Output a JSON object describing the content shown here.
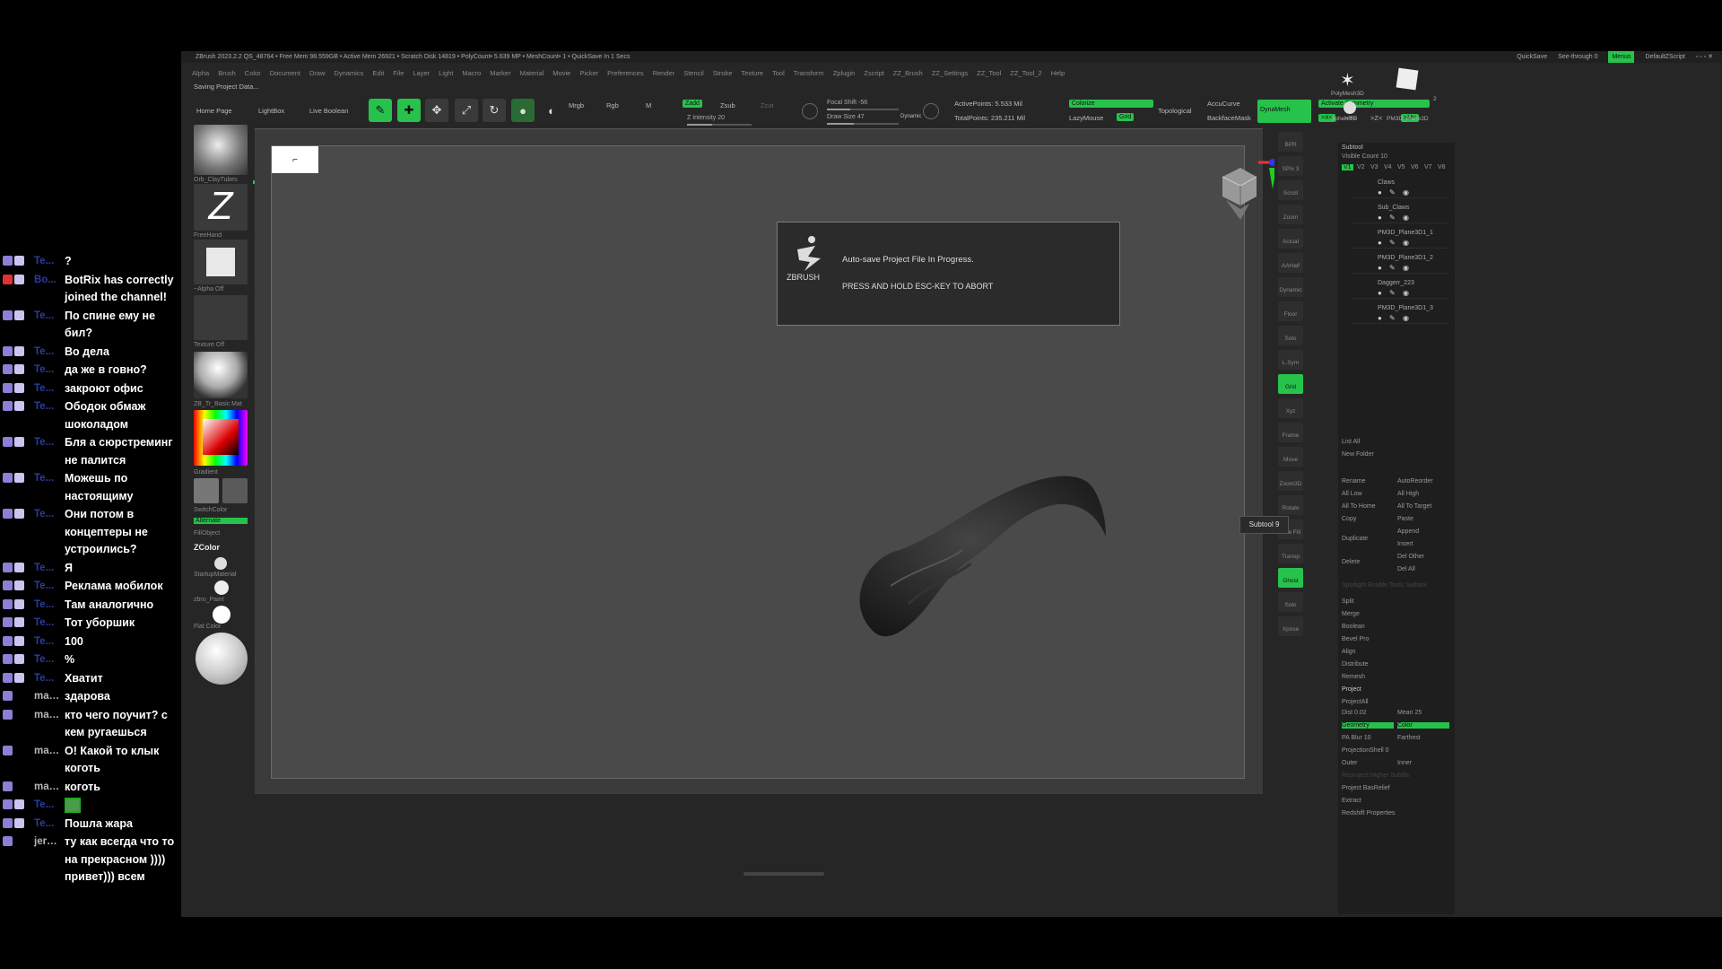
{
  "chat": {
    "messages": [
      {
        "user": "Te...",
        "text": "?",
        "badges": [
          "b",
          "b"
        ]
      },
      {
        "user": "Bo...",
        "text": "BotRix has correctly joined the channel!",
        "badges": [
          "red",
          "b"
        ],
        "light": false
      },
      {
        "user": "Te...",
        "text": "По спине ему не бил?",
        "badges": [
          "b",
          "b"
        ]
      },
      {
        "user": "Te...",
        "text": "Во дела",
        "badges": [
          "b",
          "b"
        ]
      },
      {
        "user": "Te...",
        "text": "да же в говно?",
        "badges": [
          "b",
          "b"
        ]
      },
      {
        "user": "Te...",
        "text": "закроют офис",
        "badges": [
          "b",
          "b"
        ]
      },
      {
        "user": "Te...",
        "text": "Ободок обмаж шоколадом",
        "badges": [
          "b",
          "b"
        ]
      },
      {
        "user": "Te...",
        "text": "Бля а сюрстреминг не палится",
        "badges": [
          "b",
          "b"
        ]
      },
      {
        "user": "Te...",
        "text": "Можешь по настоящиму",
        "badges": [
          "b",
          "b"
        ]
      },
      {
        "user": "Te...",
        "text": "Они потом в концептеры не устроились?",
        "badges": [
          "b",
          "b"
        ]
      },
      {
        "user": "Te...",
        "text": "Я",
        "badges": [
          "b",
          "b"
        ]
      },
      {
        "user": "Te...",
        "text": "Реклама мобилок",
        "badges": [
          "b",
          "b"
        ]
      },
      {
        "user": "Te...",
        "text": "Там аналогично",
        "badges": [
          "b",
          "b"
        ]
      },
      {
        "user": "Te...",
        "text": "Тот уборшик",
        "badges": [
          "b",
          "b"
        ]
      },
      {
        "user": "Te...",
        "text": "100",
        "badges": [
          "b",
          "b"
        ]
      },
      {
        "user": "Te...",
        "text": "%",
        "badges": [
          "b",
          "b"
        ]
      },
      {
        "user": "Te...",
        "text": "Хватит",
        "badges": [
          "b",
          "b"
        ]
      },
      {
        "user": "magi...",
        "text": "здарова",
        "badges": [
          "b"
        ],
        "light": true
      },
      {
        "user": "magi...",
        "text": "кто чего поучит? с кем ругаешься",
        "badges": [
          "b"
        ],
        "light": true
      },
      {
        "user": "magi...",
        "text": "О! Какой то клык коготь",
        "badges": [
          "b"
        ],
        "light": true
      },
      {
        "user": "magi...",
        "text": "коготь",
        "badges": [
          "b"
        ],
        "light": true
      },
      {
        "user": "Te...",
        "text": "",
        "badges": [
          "b",
          "b"
        ],
        "emote": true
      },
      {
        "user": "Te...",
        "text": "Пошла жара",
        "badges": [
          "b",
          "b"
        ]
      },
      {
        "user": "jerry_...",
        "text": "ту как всегда что то на прекрасном )))) привет))) всем",
        "badges": [
          "b"
        ],
        "light": true
      }
    ]
  },
  "zbrush": {
    "titlebar": {
      "text": "ZBrush 2023.2.2   QS_48764  • Free Mem 98.559GB • Active Mem 26921 • Scratch Disk 14819 • PolyCount• 5.639 MP • MeshCount• 1 • QuickSave In 1 Secs",
      "quicksave": "QuickSave",
      "seethrough": "See-through 0",
      "menus": "Menus",
      "script": "DefaultZScript"
    },
    "menubar": [
      "Alpha",
      "Brush",
      "Color",
      "Document",
      "Draw",
      "Dynamics",
      "Edit",
      "File",
      "Layer",
      "Light",
      "Macro",
      "Marker",
      "Material",
      "Movie",
      "Picker",
      "Preferences",
      "Render",
      "Stencil",
      "Stroke",
      "Texture",
      "Tool",
      "Transform",
      "Zplugin",
      "Zscript",
      "ZZ_Brush",
      "ZZ_Settings",
      "ZZ_Tool",
      "ZZ_Tool_2",
      "Help"
    ],
    "status": "Saving Project Data...",
    "toolbar": {
      "home": "Home Page",
      "lightbox": "LightBox",
      "liveboolean": "Live Boolean",
      "edit": "Edit",
      "draw": "Draw",
      "move": "Move",
      "scale": "Scale",
      "rotate": "Rotate",
      "mrgb": "Mrgb",
      "rgb": "Rgb",
      "m": "M",
      "zadd": "Zadd",
      "zsub": "Zsub",
      "zcut": "Zcut",
      "focal": "Focal Shift -56",
      "drawsize": "Draw Size 47",
      "zintensity": "Z Intensity 20",
      "dynamic": "Dynamic",
      "activepoints": "ActivePoints: 5.533 Mil",
      "totalpoints": "TotalPoints: 235.211 Mil",
      "colorize": "Colorize",
      "lazymouse": "LazyMouse",
      "grid": "Grid",
      "topological": "Topological",
      "accucurve": "AccuCurve",
      "backface": "BackfaceMask",
      "dynamesh": "DynaMesh",
      "symmetry": "Activate Symmetry",
      "x": ">X<",
      "y": ">Y<",
      "z": ">Z<",
      "m2": ">M<"
    },
    "leftshelf": {
      "brush": "Orb_ClayTubes",
      "stroke": "FreeHand",
      "alpha": "~Alpha Off",
      "texture": "Texture Off",
      "material": "ZB_Tr_Basic Mat",
      "gradient": "Gradient",
      "switchcolor": "SwitchColor",
      "alternate": "Alternate",
      "fillobject": "FillObject",
      "zcolor": "ZColor",
      "startupmaterial": "StartupMaterial",
      "zbrushpaint": "zbro_Paint",
      "flatcolor": "Flat Color"
    },
    "dialog": {
      "logo": "ZBRUSH",
      "line1": "Auto-save Project File In Progress.",
      "line2": "PRESS AND HOLD ESC-KEY TO ABORT"
    },
    "thumb": "⌐",
    "rightshelf": {
      "buttons": [
        "BPR",
        "SPix 3",
        "Scroll",
        "Zoom",
        "Actual",
        "AAHalf",
        "Dynamic Persp",
        "Floor",
        "Solo",
        "L.Sym",
        "Grid",
        "Xyz",
        "Frame",
        "Move",
        "Zoom3D",
        "Rotate",
        "Line Fill PolyF",
        "Transp",
        "Ghost",
        "Solo",
        "Xpose"
      ],
      "subtool_tip": "Subtool 9"
    },
    "tray": {
      "polymesh": "PolyMesh3D",
      "sphere": "Sphere3D",
      "pm3d": "PM3D_Plane3D",
      "count": "2",
      "subtool": {
        "title": "Subtool",
        "visible": "Visible Count 10",
        "tabs": [
          "V1",
          "V2",
          "V3",
          "V4",
          "V5",
          "V6",
          "V7",
          "V8"
        ],
        "items": [
          "Claws",
          "Sub_Claws",
          "PM3D_Plane3D1_1",
          "PM3D_Plane3D1_2",
          "Daggerr_223",
          "PM3D_Plane3D1_3"
        ]
      },
      "listall": "List All",
      "newfolder": "New Folder",
      "actions_left": [
        "Rename",
        "All Low",
        "All To Home",
        "Copy",
        "Duplicate",
        "Delete"
      ],
      "actions_right": [
        "AutoReorder",
        "All High",
        "All To Target",
        "Paste",
        "Append",
        "Insert",
        "Del Other",
        "Del All"
      ],
      "faded": "Spotlight Enable Tools Subtool",
      "ops": [
        "Split",
        "Merge",
        "Boolean",
        "Bevel Pro",
        "Align",
        "Distribute",
        "Remesh",
        "Project"
      ],
      "project": {
        "projectall": "ProjectAll",
        "dist": "Dist 0.02",
        "mean": "Mean 25",
        "geometry": "Geometry",
        "color": "Color",
        "pablur": "PA Blur 10",
        "farthest": "Farthest",
        "projectionshell": "ProjectionShell 0",
        "outer": "Outer",
        "inner": "Inner",
        "reproject": "Reproject Higher Subdiv",
        "bas": "Project BasRelief",
        "extract": "Extract",
        "redshift": "Redshift Properties"
      }
    }
  }
}
